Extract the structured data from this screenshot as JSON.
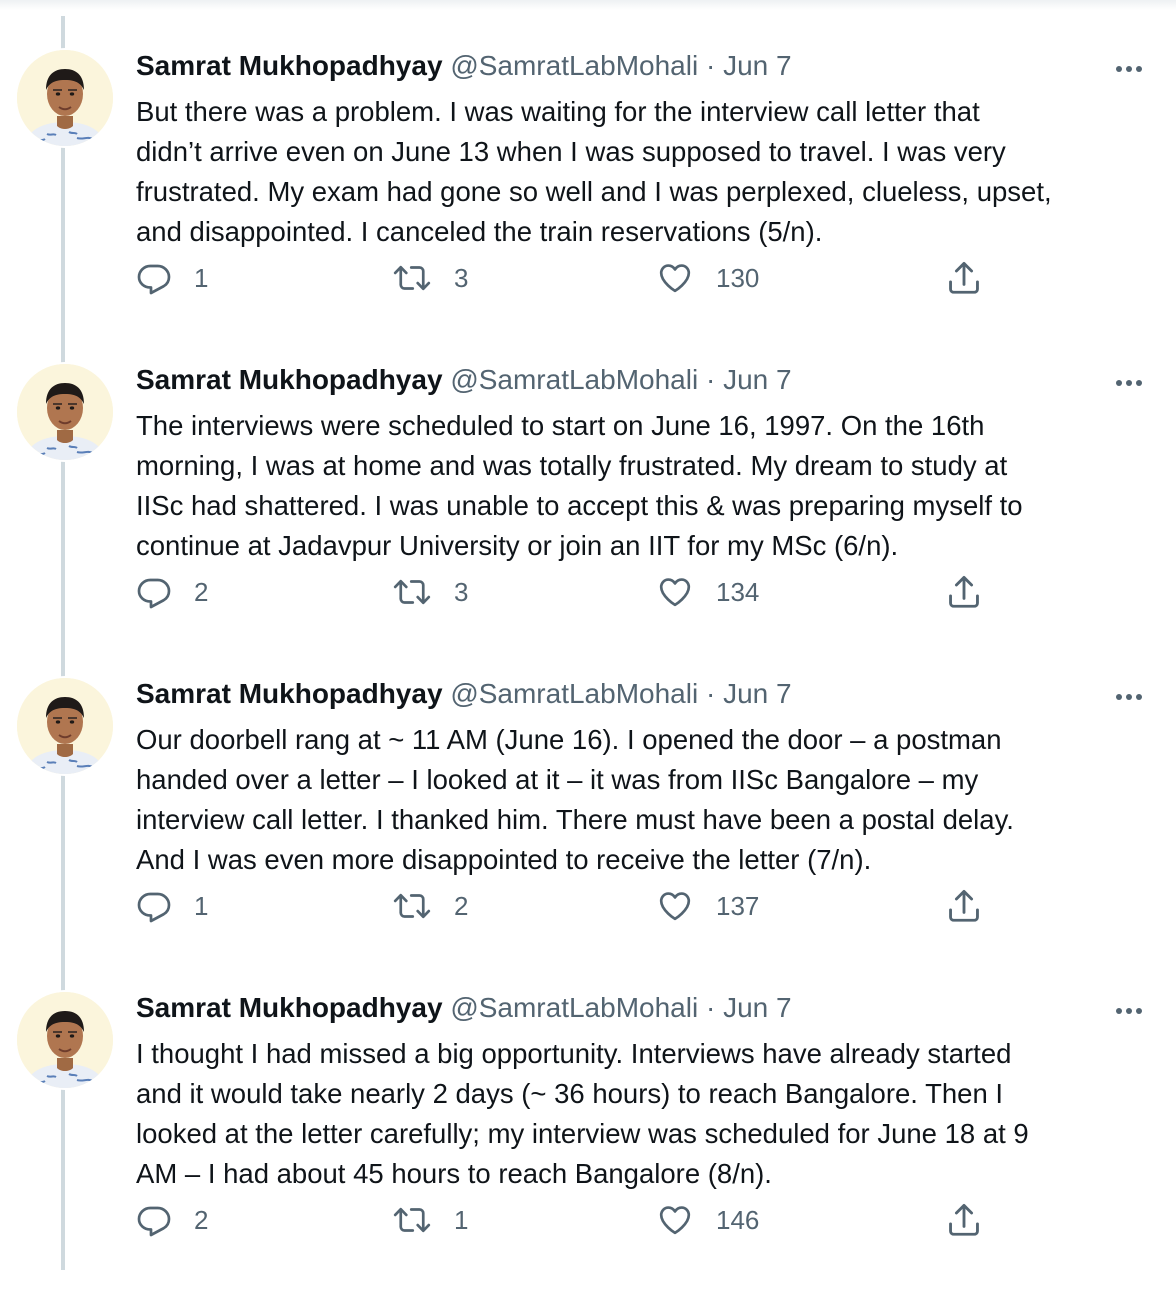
{
  "tweets": [
    {
      "name": "Samrat Mukhopadhyay",
      "handle": "@SamratLabMohali",
      "separator": "·",
      "date": "Jun 7",
      "text": "But there was a problem. I was waiting for the interview call letter that\ndidn’t arrive even on June 13 when I was supposed to travel. I was very\nfrustrated. My exam had gone so well and I was perplexed, clueless, upset,\nand disappointed. I canceled the train reservations (5/n).",
      "replies": "1",
      "retweets": "3",
      "likes": "130"
    },
    {
      "name": "Samrat Mukhopadhyay",
      "handle": "@SamratLabMohali",
      "separator": "·",
      "date": "Jun 7",
      "text": "The interviews were scheduled to start on June 16, 1997. On the 16th\nmorning, I was at home and was totally frustrated. My dream to study at\nIISc had shattered. I was unable to accept this & was preparing myself to\ncontinue at Jadavpur University or join an IIT for my MSc (6/n).",
      "replies": "2",
      "retweets": "3",
      "likes": "134"
    },
    {
      "name": "Samrat Mukhopadhyay",
      "handle": "@SamratLabMohali",
      "separator": "·",
      "date": "Jun 7",
      "text": "Our doorbell rang at ~ 11 AM (June 16). I opened the door – a postman\nhanded over a letter – I looked at it – it was from IISc Bangalore – my\ninterview call letter. I thanked him. There must have been a postal delay.\nAnd I was even more disappointed to receive the letter (7/n).",
      "replies": "1",
      "retweets": "2",
      "likes": "137"
    },
    {
      "name": "Samrat Mukhopadhyay",
      "handle": "@SamratLabMohali",
      "separator": "·",
      "date": "Jun 7",
      "text": "I thought I had missed a big opportunity. Interviews have already started\nand it would take nearly 2 days (~ 36 hours) to reach Bangalore. Then I\nlooked at the letter carefully; my interview was scheduled for June 18 at 9\nAM – I had about 45 hours to reach Bangalore (8/n).",
      "replies": "2",
      "retweets": "1",
      "likes": "146"
    }
  ],
  "icons": {
    "more": "more-horizontal-icon",
    "reply": "reply-bubble-icon",
    "retweet": "retweet-arrows-icon",
    "like": "heart-icon",
    "share": "share-upload-icon"
  },
  "colors": {
    "text_primary": "#0f1419",
    "text_secondary": "#536471",
    "thread_line": "#cfd9de"
  }
}
